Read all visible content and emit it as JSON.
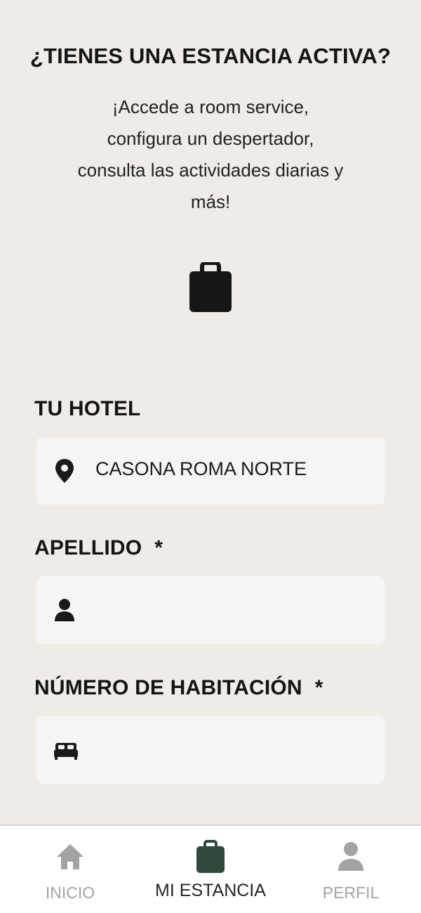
{
  "header": {
    "title": "¿TIENES UNA ESTANCIA ACTIVA?",
    "subtitle_lines": [
      "¡Accede a room service,",
      "configura un despertador,",
      "consulta las actividades diarias y",
      "más!"
    ],
    "icon": "briefcase-icon"
  },
  "form": {
    "hotel": {
      "label": "TU HOTEL",
      "icon": "location-pin-icon",
      "value": "CASONA ROMA NORTE"
    },
    "last_name": {
      "label": "APELLIDO",
      "required_mark": "*",
      "icon": "person-icon",
      "value": ""
    },
    "room_number": {
      "label": "NÚMERO DE HABITACIÓN",
      "required_mark": "*",
      "icon": "bed-icon",
      "value": ""
    }
  },
  "bottom_nav": {
    "items": [
      {
        "label": "INICIO",
        "icon": "home-icon",
        "active": false
      },
      {
        "label": "MI ESTANCIA",
        "icon": "briefcase-icon",
        "active": true
      },
      {
        "label": "PERFIL",
        "icon": "person-icon",
        "active": false
      }
    ]
  },
  "colors": {
    "background": "#efece8",
    "field_background": "#f5f5f5",
    "text": "#141414",
    "nav_active": "#2f4a3c",
    "nav_inactive": "#a3a3a3",
    "nav_active_label": "#262626"
  }
}
